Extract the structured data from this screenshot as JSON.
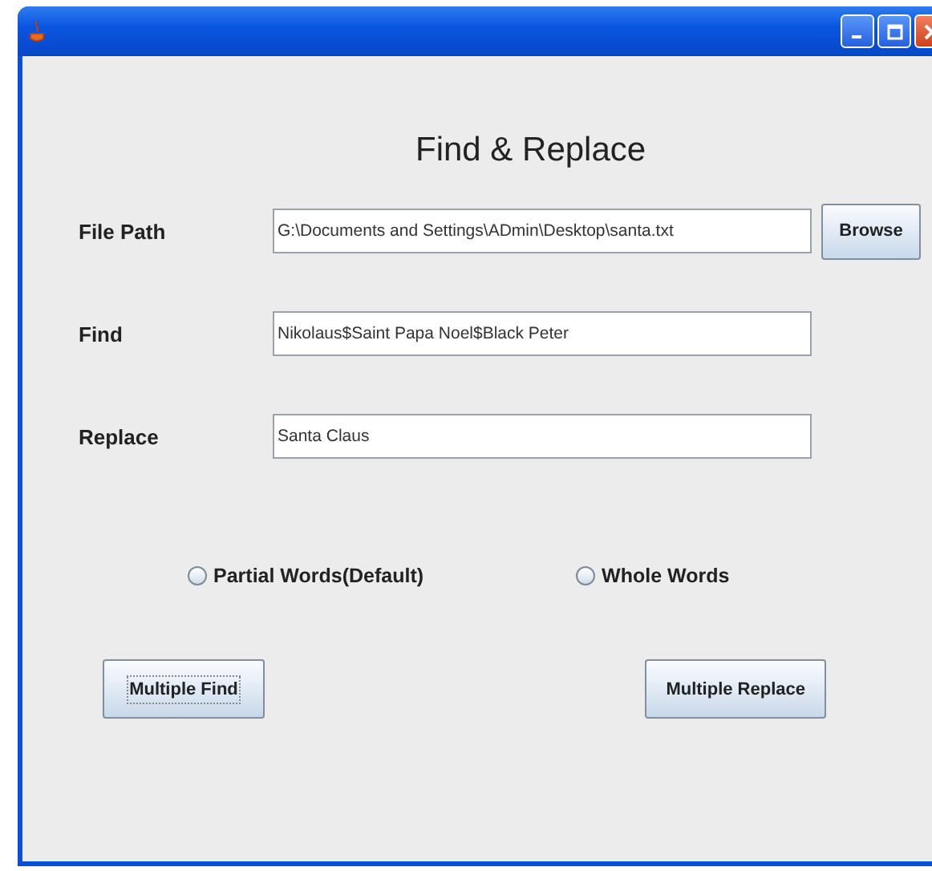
{
  "heading": "Find & Replace",
  "fields": [
    {
      "label": "File Path",
      "value": "G:\\Documents and Settings\\ADmin\\Desktop\\santa.txt",
      "button": "Browse"
    },
    {
      "label": "Find",
      "value": "Nikolaus$Saint Papa Noel$Black Peter"
    },
    {
      "label": "Replace",
      "value": "Santa Claus"
    }
  ],
  "options": [
    {
      "label": "Partial Words(Default)",
      "selected": false
    },
    {
      "label": "Whole Words",
      "selected": false
    }
  ],
  "buttons": [
    {
      "label": "Multiple Find",
      "focused": true
    },
    {
      "label": "Multiple Replace",
      "focused": false
    }
  ]
}
